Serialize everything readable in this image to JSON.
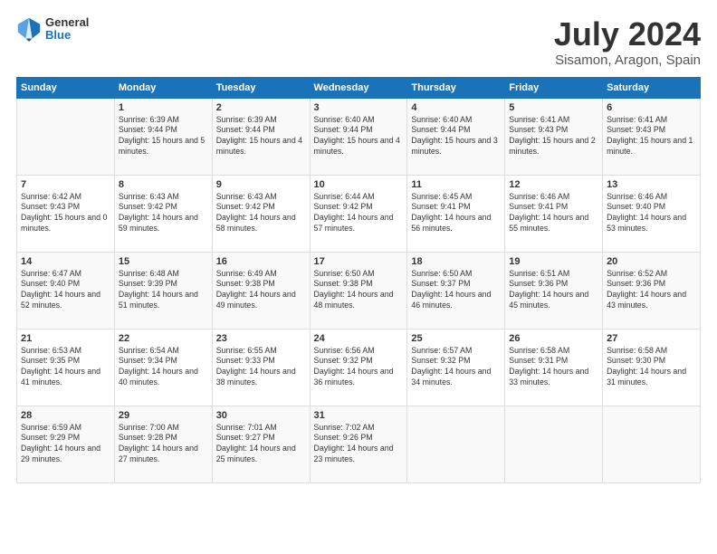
{
  "header": {
    "logo": {
      "general": "General",
      "blue": "Blue"
    },
    "month": "July 2024",
    "location": "Sisamon, Aragon, Spain"
  },
  "weekdays": [
    "Sunday",
    "Monday",
    "Tuesday",
    "Wednesday",
    "Thursday",
    "Friday",
    "Saturday"
  ],
  "weeks": [
    [
      {
        "day": "",
        "sunrise": "",
        "sunset": "",
        "daylight": ""
      },
      {
        "day": "1",
        "sunrise": "Sunrise: 6:39 AM",
        "sunset": "Sunset: 9:44 PM",
        "daylight": "Daylight: 15 hours and 5 minutes."
      },
      {
        "day": "2",
        "sunrise": "Sunrise: 6:39 AM",
        "sunset": "Sunset: 9:44 PM",
        "daylight": "Daylight: 15 hours and 4 minutes."
      },
      {
        "day": "3",
        "sunrise": "Sunrise: 6:40 AM",
        "sunset": "Sunset: 9:44 PM",
        "daylight": "Daylight: 15 hours and 4 minutes."
      },
      {
        "day": "4",
        "sunrise": "Sunrise: 6:40 AM",
        "sunset": "Sunset: 9:44 PM",
        "daylight": "Daylight: 15 hours and 3 minutes."
      },
      {
        "day": "5",
        "sunrise": "Sunrise: 6:41 AM",
        "sunset": "Sunset: 9:43 PM",
        "daylight": "Daylight: 15 hours and 2 minutes."
      },
      {
        "day": "6",
        "sunrise": "Sunrise: 6:41 AM",
        "sunset": "Sunset: 9:43 PM",
        "daylight": "Daylight: 15 hours and 1 minute."
      }
    ],
    [
      {
        "day": "7",
        "sunrise": "Sunrise: 6:42 AM",
        "sunset": "Sunset: 9:43 PM",
        "daylight": "Daylight: 15 hours and 0 minutes."
      },
      {
        "day": "8",
        "sunrise": "Sunrise: 6:43 AM",
        "sunset": "Sunset: 9:42 PM",
        "daylight": "Daylight: 14 hours and 59 minutes."
      },
      {
        "day": "9",
        "sunrise": "Sunrise: 6:43 AM",
        "sunset": "Sunset: 9:42 PM",
        "daylight": "Daylight: 14 hours and 58 minutes."
      },
      {
        "day": "10",
        "sunrise": "Sunrise: 6:44 AM",
        "sunset": "Sunset: 9:42 PM",
        "daylight": "Daylight: 14 hours and 57 minutes."
      },
      {
        "day": "11",
        "sunrise": "Sunrise: 6:45 AM",
        "sunset": "Sunset: 9:41 PM",
        "daylight": "Daylight: 14 hours and 56 minutes."
      },
      {
        "day": "12",
        "sunrise": "Sunrise: 6:46 AM",
        "sunset": "Sunset: 9:41 PM",
        "daylight": "Daylight: 14 hours and 55 minutes."
      },
      {
        "day": "13",
        "sunrise": "Sunrise: 6:46 AM",
        "sunset": "Sunset: 9:40 PM",
        "daylight": "Daylight: 14 hours and 53 minutes."
      }
    ],
    [
      {
        "day": "14",
        "sunrise": "Sunrise: 6:47 AM",
        "sunset": "Sunset: 9:40 PM",
        "daylight": "Daylight: 14 hours and 52 minutes."
      },
      {
        "day": "15",
        "sunrise": "Sunrise: 6:48 AM",
        "sunset": "Sunset: 9:39 PM",
        "daylight": "Daylight: 14 hours and 51 minutes."
      },
      {
        "day": "16",
        "sunrise": "Sunrise: 6:49 AM",
        "sunset": "Sunset: 9:38 PM",
        "daylight": "Daylight: 14 hours and 49 minutes."
      },
      {
        "day": "17",
        "sunrise": "Sunrise: 6:50 AM",
        "sunset": "Sunset: 9:38 PM",
        "daylight": "Daylight: 14 hours and 48 minutes."
      },
      {
        "day": "18",
        "sunrise": "Sunrise: 6:50 AM",
        "sunset": "Sunset: 9:37 PM",
        "daylight": "Daylight: 14 hours and 46 minutes."
      },
      {
        "day": "19",
        "sunrise": "Sunrise: 6:51 AM",
        "sunset": "Sunset: 9:36 PM",
        "daylight": "Daylight: 14 hours and 45 minutes."
      },
      {
        "day": "20",
        "sunrise": "Sunrise: 6:52 AM",
        "sunset": "Sunset: 9:36 PM",
        "daylight": "Daylight: 14 hours and 43 minutes."
      }
    ],
    [
      {
        "day": "21",
        "sunrise": "Sunrise: 6:53 AM",
        "sunset": "Sunset: 9:35 PM",
        "daylight": "Daylight: 14 hours and 41 minutes."
      },
      {
        "day": "22",
        "sunrise": "Sunrise: 6:54 AM",
        "sunset": "Sunset: 9:34 PM",
        "daylight": "Daylight: 14 hours and 40 minutes."
      },
      {
        "day": "23",
        "sunrise": "Sunrise: 6:55 AM",
        "sunset": "Sunset: 9:33 PM",
        "daylight": "Daylight: 14 hours and 38 minutes."
      },
      {
        "day": "24",
        "sunrise": "Sunrise: 6:56 AM",
        "sunset": "Sunset: 9:32 PM",
        "daylight": "Daylight: 14 hours and 36 minutes."
      },
      {
        "day": "25",
        "sunrise": "Sunrise: 6:57 AM",
        "sunset": "Sunset: 9:32 PM",
        "daylight": "Daylight: 14 hours and 34 minutes."
      },
      {
        "day": "26",
        "sunrise": "Sunrise: 6:58 AM",
        "sunset": "Sunset: 9:31 PM",
        "daylight": "Daylight: 14 hours and 33 minutes."
      },
      {
        "day": "27",
        "sunrise": "Sunrise: 6:58 AM",
        "sunset": "Sunset: 9:30 PM",
        "daylight": "Daylight: 14 hours and 31 minutes."
      }
    ],
    [
      {
        "day": "28",
        "sunrise": "Sunrise: 6:59 AM",
        "sunset": "Sunset: 9:29 PM",
        "daylight": "Daylight: 14 hours and 29 minutes."
      },
      {
        "day": "29",
        "sunrise": "Sunrise: 7:00 AM",
        "sunset": "Sunset: 9:28 PM",
        "daylight": "Daylight: 14 hours and 27 minutes."
      },
      {
        "day": "30",
        "sunrise": "Sunrise: 7:01 AM",
        "sunset": "Sunset: 9:27 PM",
        "daylight": "Daylight: 14 hours and 25 minutes."
      },
      {
        "day": "31",
        "sunrise": "Sunrise: 7:02 AM",
        "sunset": "Sunset: 9:26 PM",
        "daylight": "Daylight: 14 hours and 23 minutes."
      },
      {
        "day": "",
        "sunrise": "",
        "sunset": "",
        "daylight": ""
      },
      {
        "day": "",
        "sunrise": "",
        "sunset": "",
        "daylight": ""
      },
      {
        "day": "",
        "sunrise": "",
        "sunset": "",
        "daylight": ""
      }
    ]
  ]
}
